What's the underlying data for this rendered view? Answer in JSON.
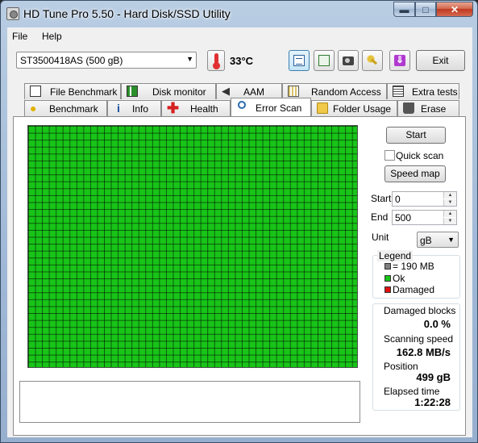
{
  "window": {
    "title": "HD Tune Pro 5.50 - Hard Disk/SSD Utility"
  },
  "caption_buttons": {
    "minimize": "▬",
    "maximize": "□",
    "close": "✕"
  },
  "menu": {
    "file": "File",
    "help": "Help"
  },
  "toolbar": {
    "drive": "ST3500418AS (500 gB)",
    "temperature": "33°C",
    "exit_label": "Exit",
    "icons": [
      "thermometer-icon",
      "copy-text-icon",
      "copy-screenshot-icon",
      "camera-icon",
      "keys-icon",
      "save-download-icon"
    ]
  },
  "tabs": {
    "row1": [
      "File Benchmark",
      "Disk monitor",
      "AAM",
      "Random Access",
      "Extra tests"
    ],
    "row2": [
      "Benchmark",
      "Info",
      "Health",
      "Error Scan",
      "Folder Usage",
      "Erase"
    ],
    "selected": "Error Scan"
  },
  "scan": {
    "start_label": "Start",
    "quick_scan_label": "Quick scan",
    "quick_scan_checked": false,
    "speed_map_label": "Speed map",
    "start_field_label": "Start",
    "start_value": "0",
    "end_field_label": "End",
    "end_value": "500",
    "unit_label": "Unit",
    "unit_value": "gB",
    "block_color_ok": "#18c418"
  },
  "legend": {
    "title": "Legend",
    "block_size": "= 190 MB",
    "ok": "Ok",
    "damaged": "Damaged",
    "colors": {
      "block": "#808080",
      "ok": "#18c418",
      "damaged": "#e01010"
    }
  },
  "stats": {
    "damaged_label": "Damaged blocks",
    "damaged_value": "0.0 %",
    "speed_label": "Scanning speed",
    "speed_value": "162.8 MB/s",
    "position_label": "Position",
    "position_value": "499 gB",
    "elapsed_label": "Elapsed time",
    "elapsed_value": "1:22:28"
  }
}
